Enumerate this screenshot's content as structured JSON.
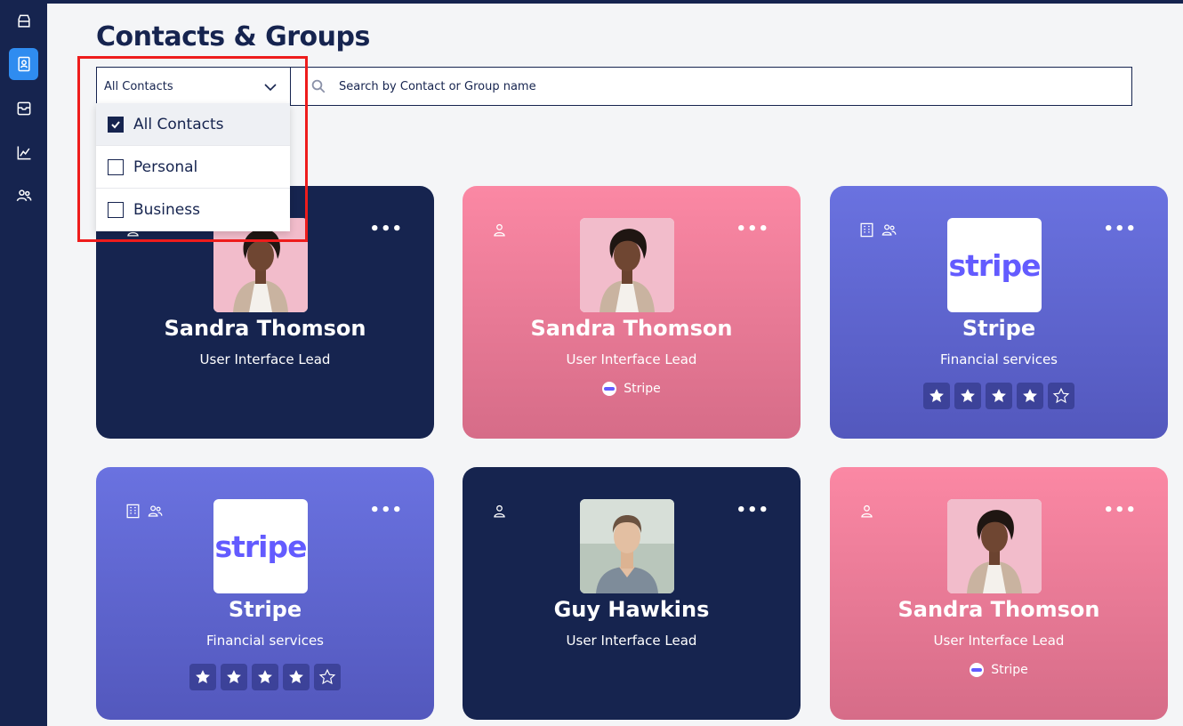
{
  "page": {
    "title": "Contacts & Groups"
  },
  "sidebar": {
    "items": [
      {
        "id": "inbox",
        "icon": "inbox-icon"
      },
      {
        "id": "contacts",
        "icon": "contact-book-icon",
        "active": true
      },
      {
        "id": "archive",
        "icon": "archive-icon"
      },
      {
        "id": "analytics",
        "icon": "chart-icon"
      },
      {
        "id": "users",
        "icon": "users-icon"
      }
    ]
  },
  "filter": {
    "selected": "All Contacts",
    "options": [
      {
        "label": "All Contacts",
        "checked": true
      },
      {
        "label": "Personal",
        "checked": false
      },
      {
        "label": "Business",
        "checked": false
      }
    ]
  },
  "search": {
    "placeholder": "Search by Contact or Group name"
  },
  "colors": {
    "navy": "#16244f",
    "pink": "#fb88a4",
    "purple": "#6a72e0",
    "active": "#2f8cf0",
    "highlight": "#ee1c1c"
  },
  "cards": [
    {
      "kind": "person",
      "theme": "navy",
      "name": "Sandra Thomson",
      "role": "User Interface Lead",
      "company": ""
    },
    {
      "kind": "person",
      "theme": "pink",
      "name": "Sandra Thomson",
      "role": "User Interface Lead",
      "company": "Stripe"
    },
    {
      "kind": "business",
      "theme": "purple",
      "name": "Stripe",
      "role": "Financial services",
      "logo_text": "stripe",
      "rating": 4,
      "rating_max": 5
    },
    {
      "kind": "business",
      "theme": "purple",
      "name": "Stripe",
      "role": "Financial services",
      "logo_text": "stripe",
      "rating": 4,
      "rating_max": 5
    },
    {
      "kind": "person",
      "theme": "navy",
      "name": "Guy Hawkins",
      "role": "User Interface Lead",
      "company": ""
    },
    {
      "kind": "person",
      "theme": "pink",
      "name": "Sandra Thomson",
      "role": "User Interface Lead",
      "company": "Stripe"
    }
  ]
}
